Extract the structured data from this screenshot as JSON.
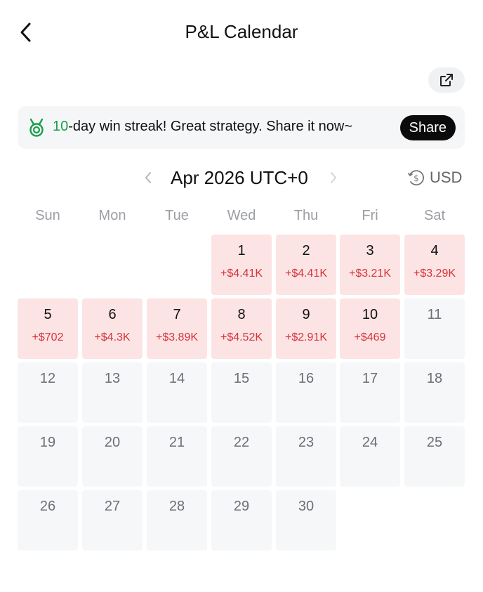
{
  "header": {
    "title": "P&L Calendar"
  },
  "banner": {
    "streak_count": "10",
    "message": "-day win streak! Great strategy. Share it now~",
    "share_label": "Share"
  },
  "month_nav": {
    "label": "Apr 2026 UTC+0",
    "currency": "USD"
  },
  "weekdays": [
    "Sun",
    "Mon",
    "Tue",
    "Wed",
    "Thu",
    "Fri",
    "Sat"
  ],
  "days": [
    {
      "day": "1",
      "pnl": "+$4.41K"
    },
    {
      "day": "2",
      "pnl": "+$4.41K"
    },
    {
      "day": "3",
      "pnl": "+$3.21K"
    },
    {
      "day": "4",
      "pnl": "+$3.29K"
    },
    {
      "day": "5",
      "pnl": "+$702"
    },
    {
      "day": "6",
      "pnl": "+$4.3K"
    },
    {
      "day": "7",
      "pnl": "+$3.89K"
    },
    {
      "day": "8",
      "pnl": "+$4.52K"
    },
    {
      "day": "9",
      "pnl": "+$2.91K"
    },
    {
      "day": "10",
      "pnl": "+$469"
    },
    {
      "day": "11",
      "pnl": ""
    },
    {
      "day": "12",
      "pnl": ""
    },
    {
      "day": "13",
      "pnl": ""
    },
    {
      "day": "14",
      "pnl": ""
    },
    {
      "day": "15",
      "pnl": ""
    },
    {
      "day": "16",
      "pnl": ""
    },
    {
      "day": "17",
      "pnl": ""
    },
    {
      "day": "18",
      "pnl": ""
    },
    {
      "day": "19",
      "pnl": ""
    },
    {
      "day": "20",
      "pnl": ""
    },
    {
      "day": "21",
      "pnl": ""
    },
    {
      "day": "22",
      "pnl": ""
    },
    {
      "day": "23",
      "pnl": ""
    },
    {
      "day": "24",
      "pnl": ""
    },
    {
      "day": "25",
      "pnl": ""
    },
    {
      "day": "26",
      "pnl": ""
    },
    {
      "day": "27",
      "pnl": ""
    },
    {
      "day": "28",
      "pnl": ""
    },
    {
      "day": "29",
      "pnl": ""
    },
    {
      "day": "30",
      "pnl": ""
    }
  ],
  "colors": {
    "profit_bg": "#fde4e4",
    "profit_text": "#d6333b",
    "streak_green": "#1a9e4b",
    "empty_day_bg": "#f6f7f9"
  },
  "icons": [
    "back-arrow-icon",
    "share-external-icon",
    "trophy-icon",
    "chevron-left-icon",
    "chevron-right-icon",
    "dollar-coin-icon"
  ]
}
